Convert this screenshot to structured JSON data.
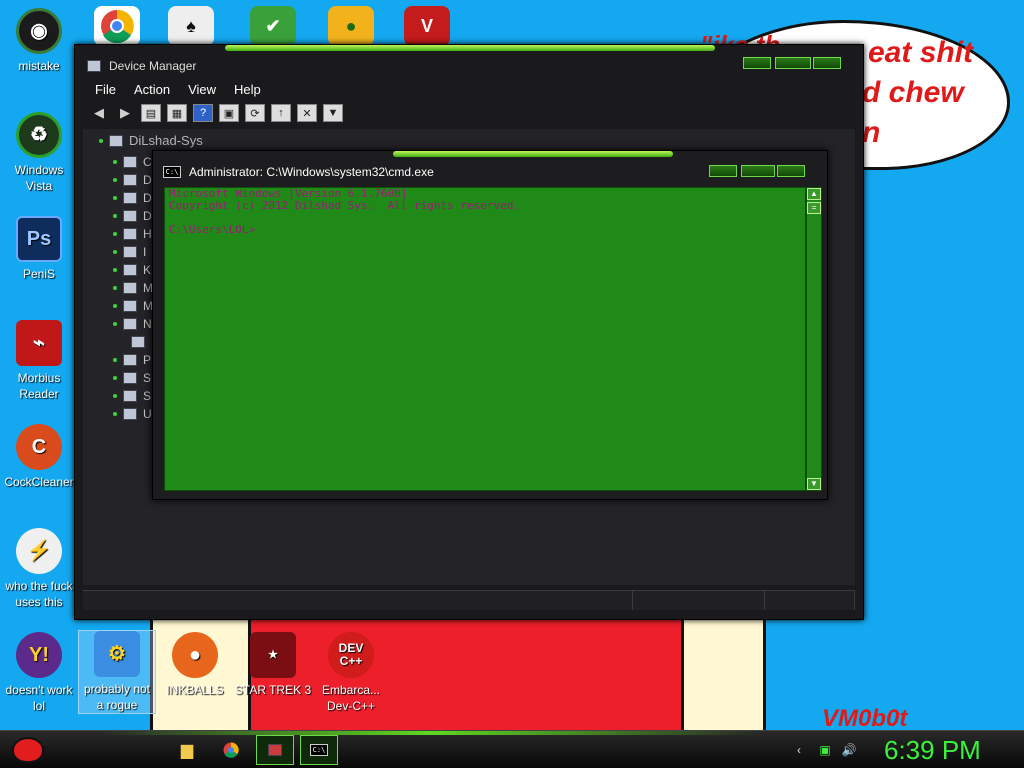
{
  "wallpaper": {
    "bubble_lines": [
      "eat shit",
      "d chew",
      "n"
    ],
    "bubble_line0_prefix": "\"ike th ",
    "brand": "VM0b0t"
  },
  "desktop_icons": [
    {
      "label": "mistake",
      "icon": "cd-drive-icon",
      "color": "#1b1b1b"
    },
    {
      "label": "Windows Vista",
      "icon": "recycle-bin-icon",
      "color": "#1d3a1d"
    },
    {
      "label": "PeniS",
      "icon": "photoshop-icon",
      "color": "#0f2d5c"
    },
    {
      "label": "Morbius Reader",
      "icon": "acrobat-reader-icon",
      "color": "#c01818"
    },
    {
      "label": "CockCleaner",
      "icon": "ccleaner-icon",
      "color": "#d94a1c"
    },
    {
      "label": "who the fuck uses this",
      "icon": "avast-icon",
      "color": "#f0f0f0"
    },
    {
      "label": "doesn't work lol",
      "icon": "yahoo-messenger-icon",
      "color": "#5b2a8a"
    }
  ],
  "bottom_icons": [
    {
      "label": "probably not a rogue",
      "icon": "control-panel-icon"
    },
    {
      "label": "INKBALLS",
      "icon": "inkball-icon"
    },
    {
      "label": "STAR TREK 3",
      "icon": "star-wars-game-icon"
    },
    {
      "label": "Embarca... Dev-C++",
      "icon": "devcpp-icon",
      "badge": "DEV C++"
    }
  ],
  "device_manager": {
    "title": "Device Manager",
    "menu": [
      "File",
      "Action",
      "View",
      "Help"
    ],
    "root": "DiLshad-Sys",
    "tree_initials": [
      "C",
      "D",
      "D",
      "D",
      "H",
      "I",
      "K",
      "M",
      "M",
      "N",
      "",
      "P",
      "S",
      "S",
      "U"
    ]
  },
  "cmd": {
    "title": "Administrator: C:\\Windows\\system32\\cmd.exe",
    "line1": "Microsoft Windows [Version 6.1.7600]",
    "line2": "Copyright (c) 2012 Dilshad Sys.  All rights reserved.",
    "line3": "C:\\Users\\LOL>"
  },
  "taskbar": {
    "clock": "6:39 PM"
  },
  "colors": {
    "desktop_bg": "#14a8f0",
    "console_bg": "#1f8a17",
    "console_text": "#a0187a",
    "accent_green": "#3bf23b"
  }
}
